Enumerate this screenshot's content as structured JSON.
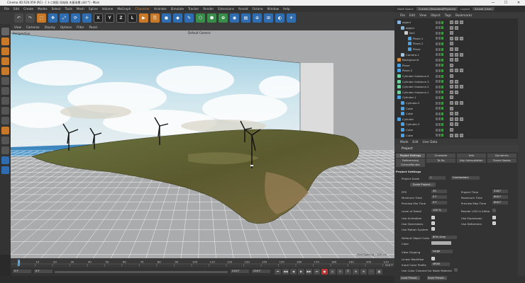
{
  "window": {
    "title": "Cinema 4D R20.059 (RC) - [ 十二地形 风电场 木屋场景.c4d *] - Main",
    "minimize": "—",
    "maximize": "☐",
    "close": "✕"
  },
  "main_menu": [
    "File",
    "Edit",
    "Create",
    "Modes",
    "Select",
    "Tools",
    "Mesh",
    "Spline",
    "Volume",
    "MoGraph",
    "Character",
    "Animate",
    "Simulate",
    "Tracker",
    "Render",
    "Extensions",
    "Arnold",
    "Octane",
    "Window",
    "Help"
  ],
  "main_menu_highlight": "Character",
  "toolbar": {
    "buttons": [
      "↶",
      "↷",
      "⬚",
      "✥",
      "⤢",
      "⟳",
      "✛",
      "X",
      "Y",
      "Z",
      "L",
      "▶",
      "⎘",
      "◼",
      "◆",
      "✎",
      "⬡",
      "⬢",
      "✿",
      "◉",
      "▤",
      "⊕",
      "⊞",
      "◐",
      "☀"
    ]
  },
  "viewport_menu": [
    "View",
    "Cameras",
    "Display",
    "Options",
    "Filter",
    "Panel"
  ],
  "viewport": {
    "label": "Perspective",
    "camera_label": "Default Camera",
    "grid_spacing_label": "Grid Spacing : 100 cm"
  },
  "timeline": {
    "ticks": [
      "0",
      "10",
      "20",
      "30",
      "40",
      "50",
      "60",
      "70",
      "80",
      "90",
      "100",
      "110",
      "120",
      "130",
      "140",
      "150",
      "160",
      "170",
      "180",
      "190",
      "200",
      "210"
    ],
    "end_frame": "210 F"
  },
  "playback": {
    "current_frame": "0 F",
    "start": "0 F",
    "preview_end": "210 F",
    "end": "210 F"
  },
  "right_panel": {
    "node_space_label": "Node Space",
    "node_space_value": "Current (Standard/Physical)",
    "layout_label": "Layout",
    "layout_value": "Arnold (User)",
    "menu": [
      "File",
      "Edit",
      "View",
      "Object",
      "Tags",
      "Bookmarks"
    ]
  },
  "objects": [
    {
      "name": "object",
      "level": 0,
      "color": "#8ab4e0"
    },
    {
      "name": "object",
      "level": 1,
      "color": "#8ab4e0"
    },
    {
      "name": "Null",
      "level": 2,
      "color": "#cccccc"
    },
    {
      "name": "Plane.1",
      "level": 3,
      "color": "#4aa0e0"
    },
    {
      "name": "Plane.2",
      "level": 3,
      "color": "#4aa0e0"
    },
    {
      "name": "Plane",
      "level": 3,
      "color": "#4aa0e0"
    },
    {
      "name": "Camera.1",
      "level": 1,
      "color": "#9ec4e0"
    },
    {
      "name": "Background",
      "level": 0,
      "color": "#d08a3a"
    },
    {
      "name": "Plane",
      "level": 0,
      "color": "#4aa0e0"
    },
    {
      "name": "Plane.2",
      "level": 0,
      "color": "#4aa0e0"
    },
    {
      "name": "Cylinder Instance.4",
      "level": 0,
      "color": "#6fd0a0"
    },
    {
      "name": "Cylinder Instance.3",
      "level": 0,
      "color": "#6fd0a0"
    },
    {
      "name": "Cylinder Instance.2",
      "level": 0,
      "color": "#6fd0a0"
    },
    {
      "name": "Cylinder Instance.1",
      "level": 0,
      "color": "#6fd0a0"
    },
    {
      "name": "Cylinder.1",
      "level": 0,
      "color": "#4aa0e0"
    },
    {
      "name": "Cylinder.2",
      "level": 1,
      "color": "#4aa0e0"
    },
    {
      "name": "Cube",
      "level": 1,
      "color": "#4aa0e0"
    },
    {
      "name": "Cube",
      "level": 1,
      "color": "#4aa0e0"
    },
    {
      "name": "Cylinder",
      "level": 0,
      "color": "#4aa0e0"
    },
    {
      "name": "Cylinder.2",
      "level": 1,
      "color": "#4aa0e0"
    },
    {
      "name": "Cube",
      "level": 1,
      "color": "#4aa0e0"
    },
    {
      "name": "Cube",
      "level": 1,
      "color": "#4aa0e0"
    }
  ],
  "attributes": {
    "menu": [
      "Mode",
      "Edit",
      "User Data"
    ],
    "title": "Project",
    "tabs": [
      [
        "Project Settings",
        "Cineware",
        "Info",
        "Dynamics"
      ],
      [
        "Referencing",
        "To Do",
        "Key Interpolation",
        "Scene Nodes"
      ],
      [
        "OctaneRender"
      ]
    ],
    "active_tab": "Project Settings",
    "section": "Project Settings",
    "project_scale_label": "Project Scale",
    "project_scale_value": "1",
    "project_scale_unit": "Centimeters",
    "scale_project_button": "Scale Project...",
    "fps_label": "FPS",
    "fps_value": "30",
    "project_time_label": "Project Time",
    "project_time_value": "318 F",
    "min_time_label": "Minimum Time",
    "min_time_value": "0 F",
    "max_time_label": "Maximum Time",
    "max_time_value": "600 F",
    "preview_min_label": "Preview Min Time",
    "preview_min_value": "0 F",
    "preview_max_label": "Preview Max Time",
    "preview_max_value": "600 F",
    "lod_label": "Level of Detail",
    "lod_value": "100 %",
    "render_lod_label": "Render LOD in Editor",
    "use_animation_label": "Use Animation",
    "use_expression_label": "Use Expression",
    "use_generators_label": "Use Generators",
    "use_deformers_label": "Use Deformers",
    "use_motion_label": "Use Motion System",
    "default_color_label": "Default Object Color",
    "default_color_value": "80% Grey",
    "color_label": "Color",
    "view_clipping_label": "View Clipping",
    "view_clipping_value": "Large",
    "linear_workflow_label": "Linear Workflow",
    "input_color_label": "Input Color Profile",
    "input_color_value": "sRGB",
    "use_color_channel_label": "Use Color Channel for Node Material",
    "load_preset_button": "Load Preset...",
    "save_preset_button": "Save Preset..."
  }
}
